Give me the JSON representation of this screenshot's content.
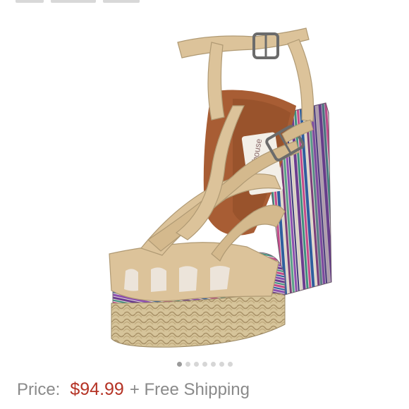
{
  "carousel": {
    "image": {
      "icon": "sandal-product-photo",
      "description_icon_name": "platform-sandal-image"
    },
    "dots_count": 7,
    "active_index": 0
  },
  "price": {
    "label": "Price:",
    "value": "$94.99",
    "shipping": "+ Free Shipping"
  },
  "colors": {
    "price_accent": "#b53325",
    "muted_text": "#8a8a8a",
    "strap": "#dcc39a",
    "insole": "#a85d34"
  }
}
